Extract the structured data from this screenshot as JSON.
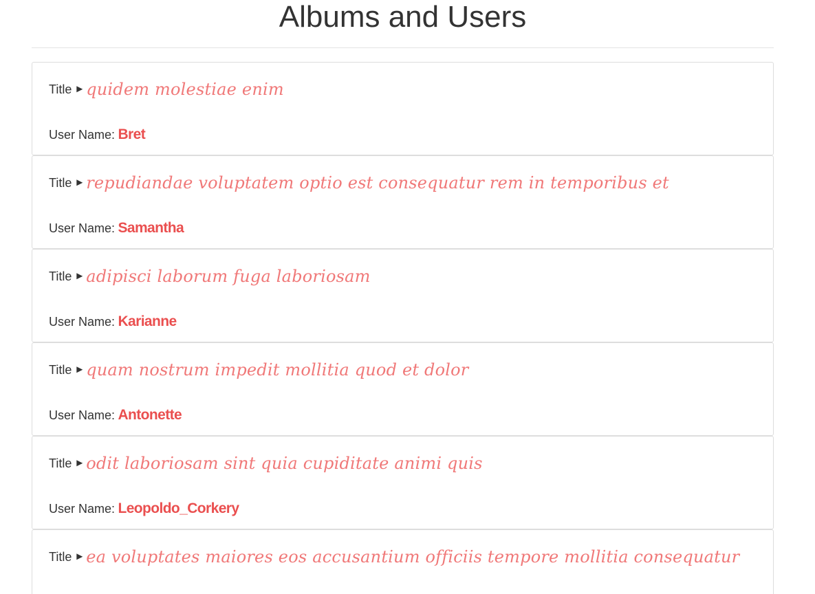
{
  "page": {
    "heading": "Albums and Users"
  },
  "labels": {
    "title": "Title",
    "arrow": "►",
    "user_name": "User Name:"
  },
  "albums": [
    {
      "title": "quidem molestiae enim",
      "user": "Bret"
    },
    {
      "title": "repudiandae voluptatem optio est consequatur rem in temporibus et",
      "user": "Samantha"
    },
    {
      "title": "adipisci laborum fuga laboriosam",
      "user": "Karianne"
    },
    {
      "title": "quam nostrum impedit mollitia quod et dolor",
      "user": "Antonette"
    },
    {
      "title": "odit laboriosam sint quia cupiditate animi quis",
      "user": "Leopoldo_Corkery"
    },
    {
      "title": "ea voluptates maiores eos accusantium officiis tempore mollitia consequatur",
      "user": ""
    }
  ],
  "colors": {
    "album_title": "#f07878",
    "user_name": "#ea4f4f",
    "text": "#333333",
    "border": "#dddddd"
  }
}
